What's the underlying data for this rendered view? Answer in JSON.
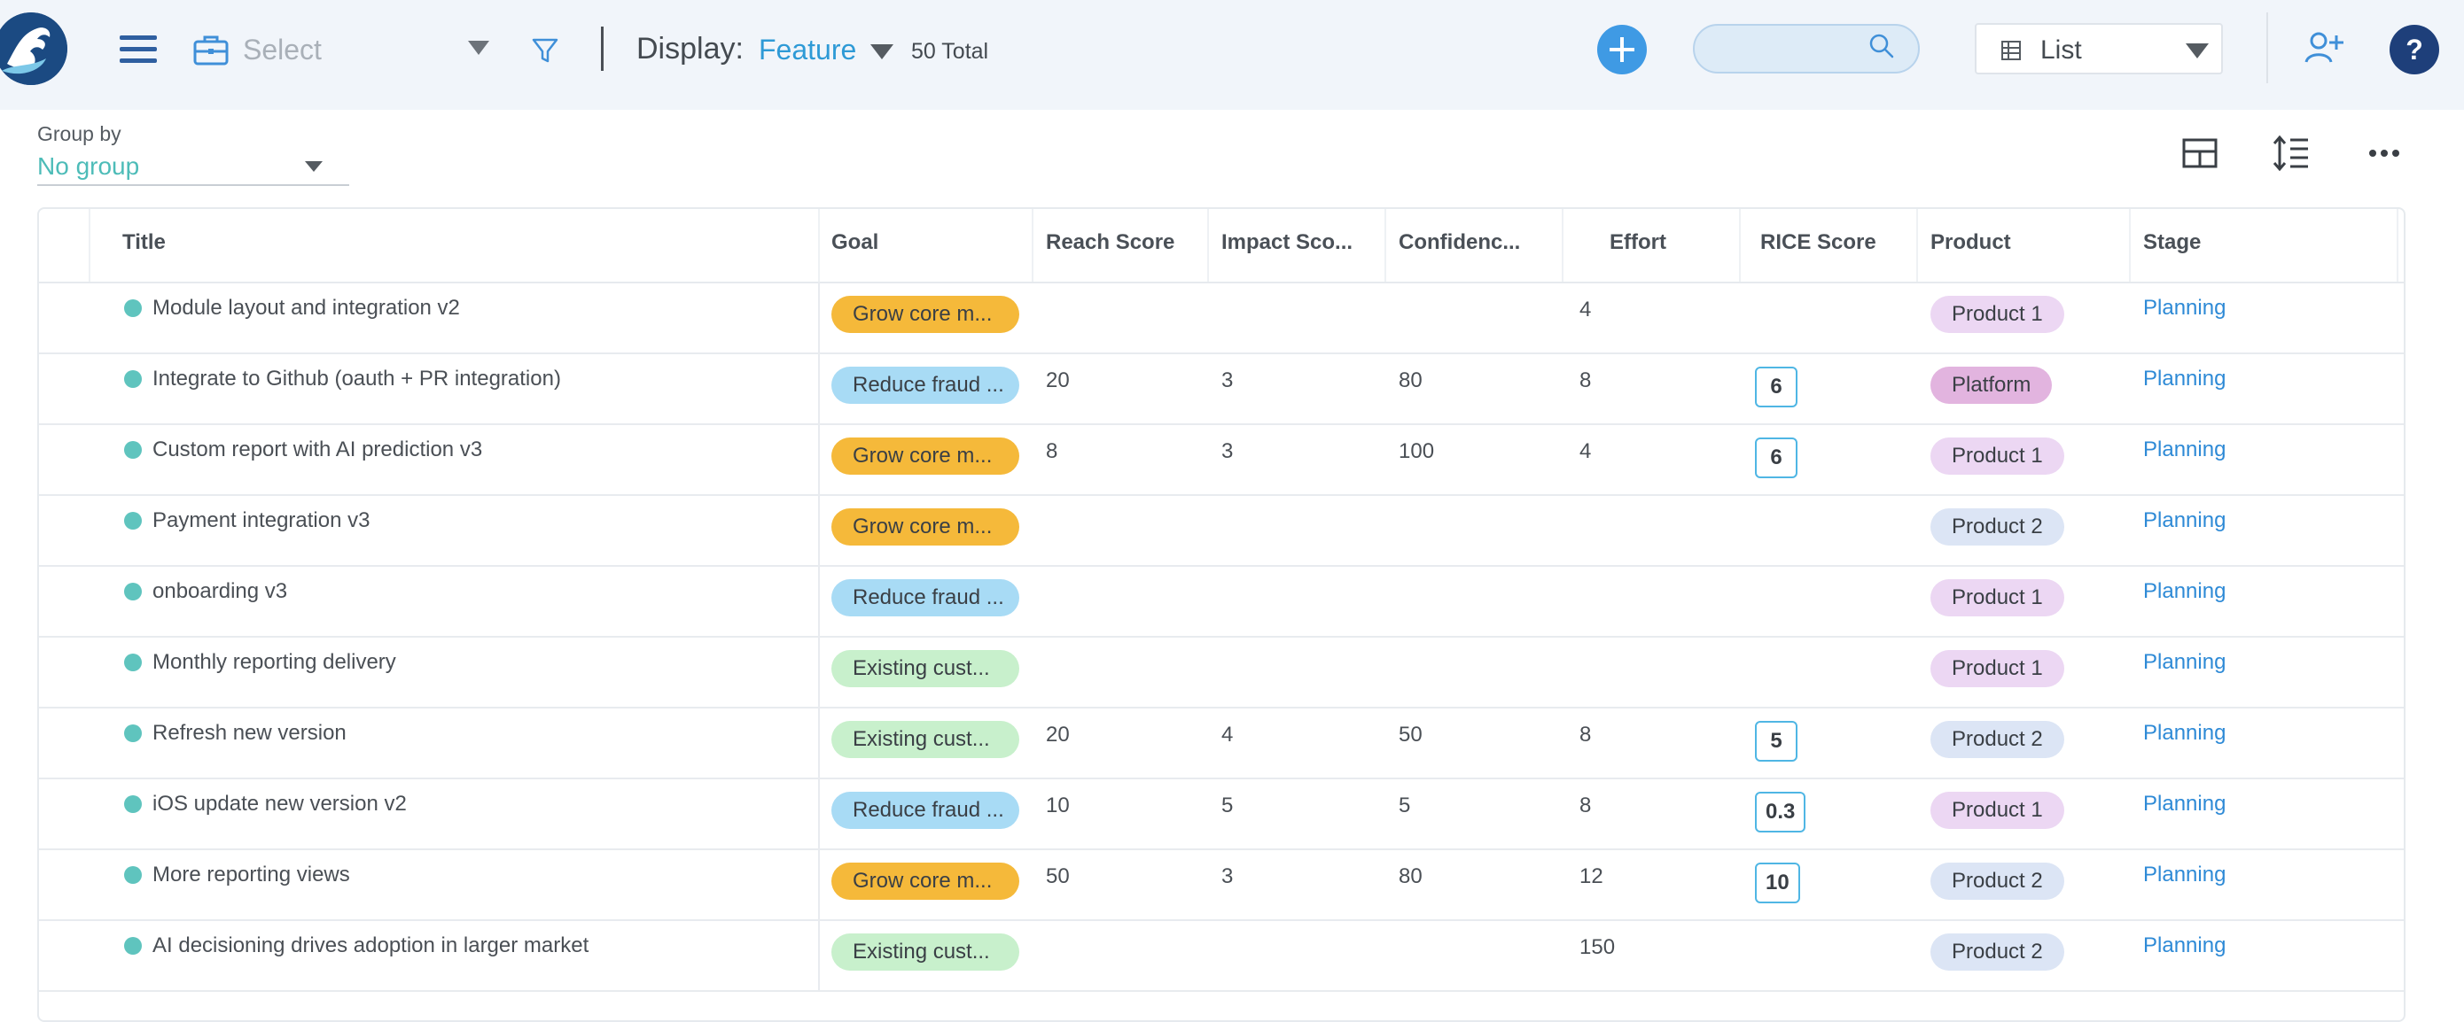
{
  "header": {
    "select_placeholder": "Select",
    "display_label": "Display:",
    "display_value": "Feature",
    "total": "50 Total",
    "search_placeholder": "",
    "view_label": "List",
    "help_label": "?"
  },
  "groupby": {
    "label": "Group by",
    "value": "No group"
  },
  "table": {
    "columns": [
      "Title",
      "Goal",
      "Reach Score",
      "Impact Sco...",
      "Confidenc...",
      "Effort",
      "RICE Score",
      "Product",
      "Stage"
    ],
    "rows": [
      {
        "title": "Module layout and integration v2",
        "goal": "Grow core m...",
        "reach": "",
        "impact": "",
        "confidence": "",
        "effort": "4",
        "rice": "",
        "product": "Product 1",
        "stage": "Planning"
      },
      {
        "title": "Integrate to Github (oauth + PR integration)",
        "goal": "Reduce fraud ...",
        "reach": "20",
        "impact": "3",
        "confidence": "80",
        "effort": "8",
        "rice": "6",
        "product": "Platform",
        "stage": "Planning"
      },
      {
        "title": "Custom report with AI prediction v3",
        "goal": "Grow core m...",
        "reach": "8",
        "impact": "3",
        "confidence": "100",
        "effort": "4",
        "rice": "6",
        "product": "Product 1",
        "stage": "Planning"
      },
      {
        "title": "Payment integration v3",
        "goal": "Grow core m...",
        "reach": "",
        "impact": "",
        "confidence": "",
        "effort": "",
        "rice": "",
        "product": "Product 2",
        "stage": "Planning"
      },
      {
        "title": "onboarding v3",
        "goal": "Reduce fraud ...",
        "reach": "",
        "impact": "",
        "confidence": "",
        "effort": "",
        "rice": "",
        "product": "Product 1",
        "stage": "Planning"
      },
      {
        "title": "Monthly reporting delivery",
        "goal": "Existing cust...",
        "reach": "",
        "impact": "",
        "confidence": "",
        "effort": "",
        "rice": "",
        "product": "Product 1",
        "stage": "Planning"
      },
      {
        "title": "Refresh new version",
        "goal": "Existing cust...",
        "reach": "20",
        "impact": "4",
        "confidence": "50",
        "effort": "8",
        "rice": "5",
        "product": "Product 2",
        "stage": "Planning"
      },
      {
        "title": "iOS update new version v2",
        "goal": "Reduce fraud ...",
        "reach": "10",
        "impact": "5",
        "confidence": "5",
        "effort": "8",
        "rice": "0.3",
        "product": "Product 1",
        "stage": "Planning"
      },
      {
        "title": "More reporting views",
        "goal": "Grow core m...",
        "reach": "50",
        "impact": "3",
        "confidence": "80",
        "effort": "12",
        "rice": "10",
        "product": "Product 2",
        "stage": "Planning"
      },
      {
        "title": "AI decisioning drives adoption in larger market",
        "goal": "Existing cust...",
        "reach": "",
        "impact": "",
        "confidence": "",
        "effort": "150",
        "rice": "",
        "product": "Product 2",
        "stage": "Planning"
      }
    ]
  },
  "colors": {
    "goal_grow": "#f5b93a",
    "goal_reduce": "#a8dbf5",
    "goal_existing": "#c8f0cc",
    "product_1": "#ecd7f3",
    "product_2": "#dce5f5",
    "platform": "#e2b4df",
    "accent": "#3f9ae4",
    "stage_link": "#2e8ad6"
  },
  "icons": [
    "menu-icon",
    "briefcase-icon",
    "filter-icon",
    "plus-icon",
    "search-icon",
    "grid-icon",
    "add-user-icon",
    "help-icon",
    "layout-icon",
    "row-height-icon",
    "more-icon"
  ]
}
